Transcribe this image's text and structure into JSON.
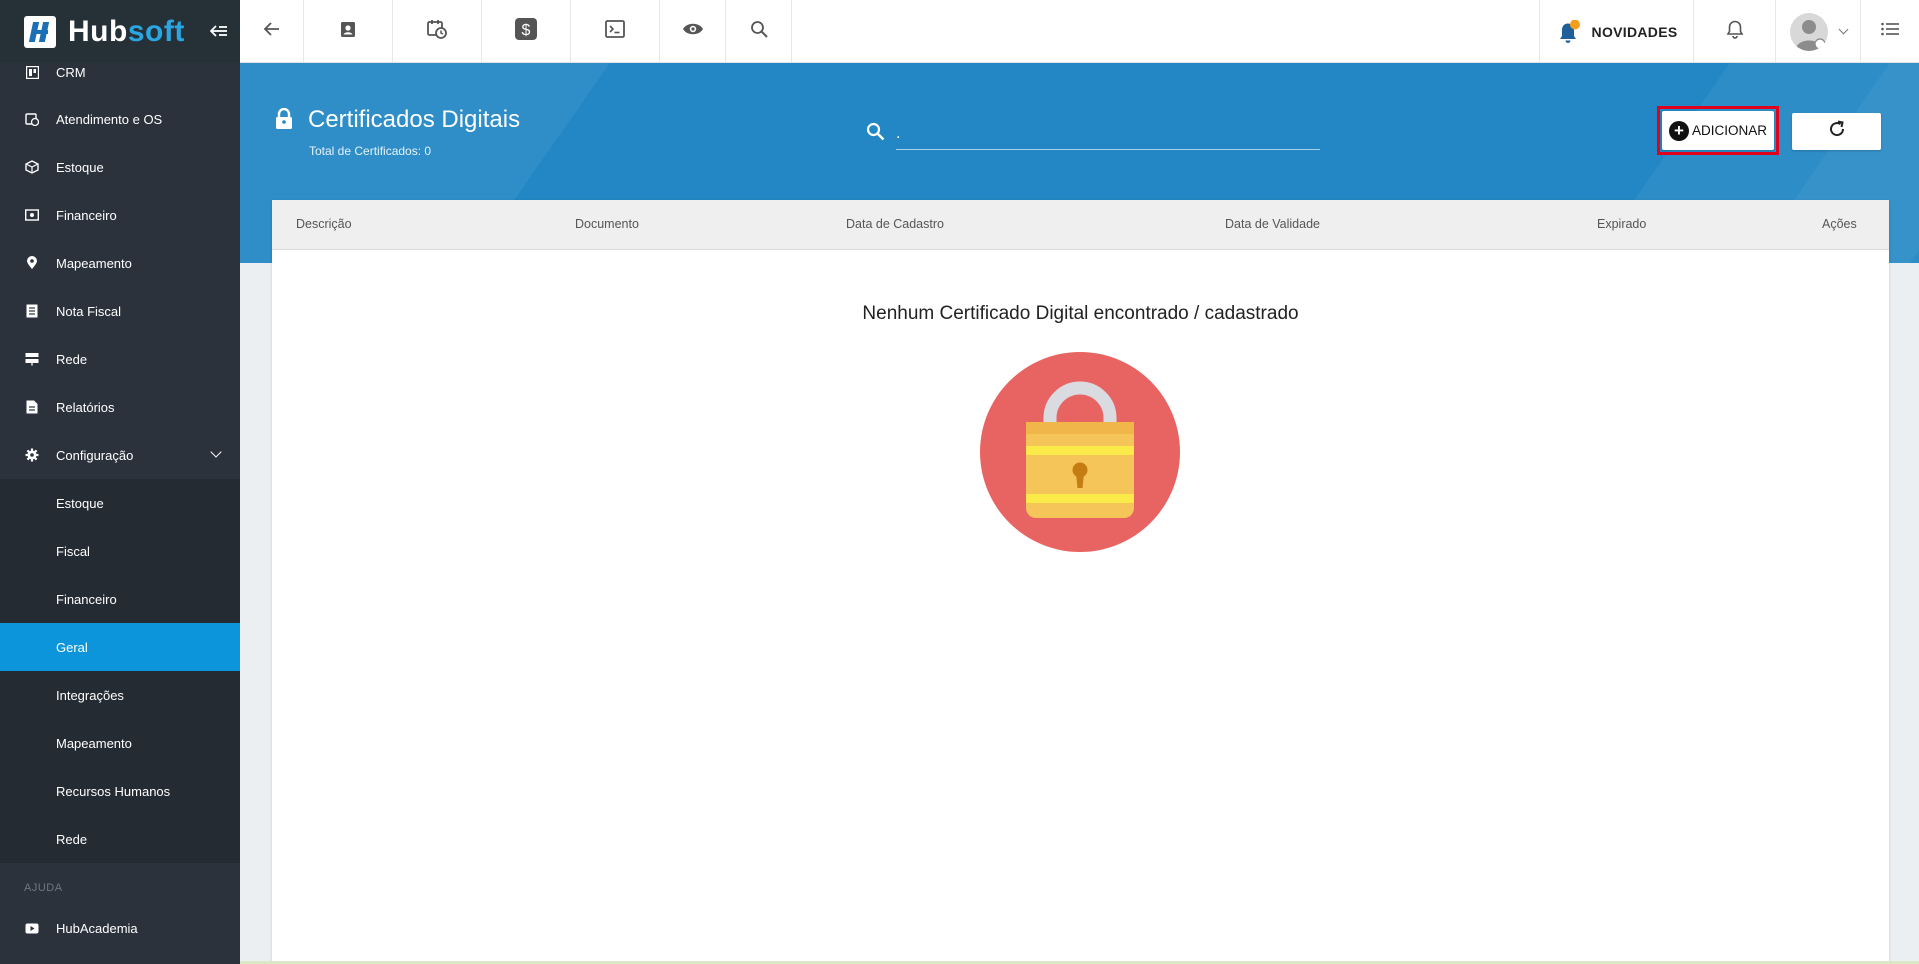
{
  "app": {
    "logo_hub": "Hub",
    "logo_soft": "soft"
  },
  "sidebar": {
    "items": [
      {
        "label": "CRM",
        "icon": "board-icon"
      },
      {
        "label": "Atendimento e OS",
        "icon": "calendar-clock-icon"
      },
      {
        "label": "Estoque",
        "icon": "box-icon"
      },
      {
        "label": "Financeiro",
        "icon": "money-icon"
      },
      {
        "label": "Mapeamento",
        "icon": "map-pin-icon"
      },
      {
        "label": "Nota Fiscal",
        "icon": "document-icon"
      },
      {
        "label": "Rede",
        "icon": "server-icon"
      },
      {
        "label": "Relatórios",
        "icon": "report-icon"
      },
      {
        "label": "Configuração",
        "icon": "gear-icon"
      }
    ],
    "config_sub": [
      {
        "label": "Estoque"
      },
      {
        "label": "Fiscal"
      },
      {
        "label": "Financeiro"
      },
      {
        "label": "Geral"
      },
      {
        "label": "Integrações"
      },
      {
        "label": "Mapeamento"
      },
      {
        "label": "Recursos Humanos"
      },
      {
        "label": "Rede"
      }
    ],
    "active": "Geral",
    "help_section": "AJUDA",
    "help_items": [
      {
        "label": "HubAcademia",
        "icon": "youtube-icon"
      }
    ]
  },
  "topbar": {
    "icons": [
      "back-arrow-icon",
      "contact-card-icon",
      "calendar-clock-icon",
      "dollar-icon",
      "terminal-icon",
      "eye-icon",
      "search-icon"
    ],
    "novidades_label": "NOVIDADES"
  },
  "page": {
    "title": "Certificados Digitais",
    "subtitle": "Total de Certificados: 0",
    "search_value": ".",
    "add_label": "ADICIONAR"
  },
  "table": {
    "columns": [
      "Descrição",
      "Documento",
      "Data de Cadastro",
      "Data de Validade",
      "Expirado",
      "Ações"
    ],
    "rows": [],
    "empty_message": "Nenhum Certificado Digital encontrado / cadastrado"
  },
  "colors": {
    "accent": "#0d95dc",
    "banner": "#2287c4",
    "sidebar": "#2b323c",
    "highlight": "#e3001b"
  }
}
